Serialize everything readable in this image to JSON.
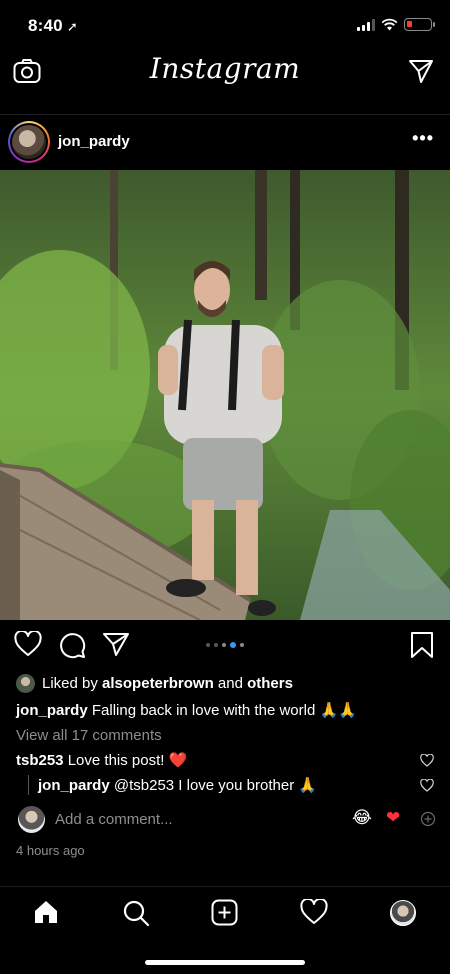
{
  "status_bar": {
    "time": "8:40",
    "location_glyph": "➚"
  },
  "top_bar": {
    "logo": "Instagram",
    "left_icon": "camera-icon",
    "right_icon": "direct-send-icon"
  },
  "post": {
    "username": "jon_pardy",
    "more_glyph": "•••",
    "carousel": {
      "count": 5,
      "active_index": 3
    },
    "likes": {
      "prefix": "Liked by",
      "user": "alsopeterbrown",
      "conj": "and",
      "others": "others"
    },
    "caption": {
      "user": "jon_pardy",
      "text": "Falling back in love with the world 🙏🙏"
    },
    "view_all": "View all 17 comments",
    "comments": [
      {
        "user": "tsb253",
        "text": "Love this post! ❤️"
      },
      {
        "user": "jon_pardy",
        "text": "@tsb253 I love you brother 🙏"
      }
    ],
    "add_comment_placeholder": "Add a comment...",
    "quick_emojis": [
      "😂",
      "❤"
    ],
    "time_ago": "4 hours ago"
  },
  "bottom_nav": [
    "home-icon",
    "search-icon",
    "new-post-icon",
    "activity-heart-icon",
    "profile-avatar"
  ],
  "colors": {
    "background": "#000000",
    "secondary_text": "#8e8e8e",
    "accent": "#3897f0",
    "heart": "#ff3040"
  }
}
